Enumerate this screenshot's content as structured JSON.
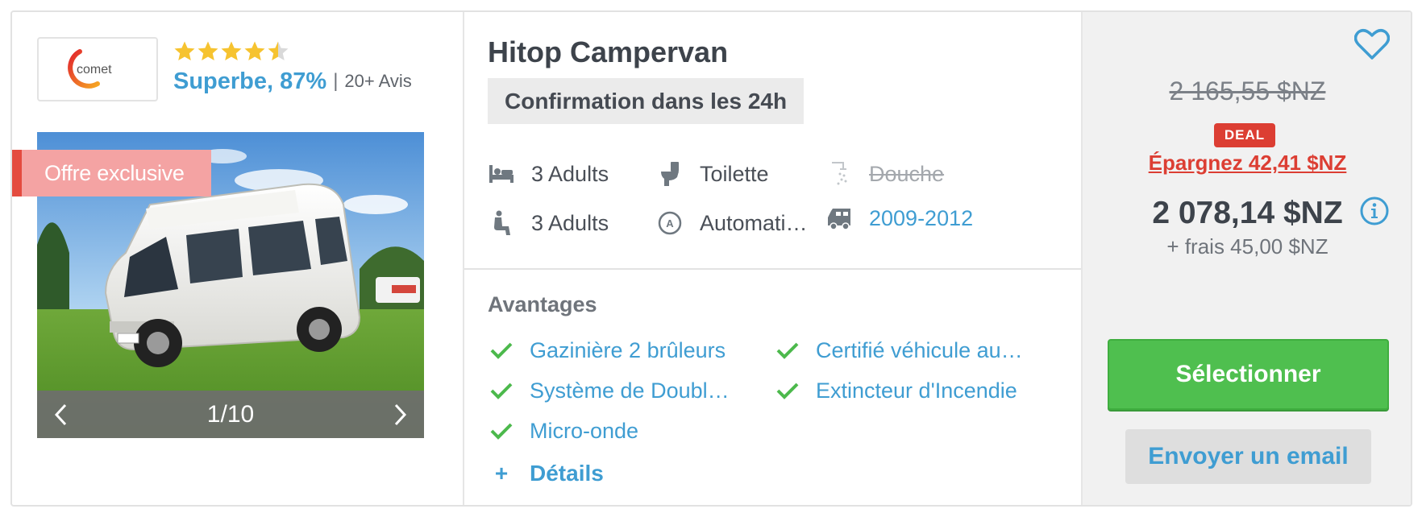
{
  "listing": {
    "supplier_logo_text": "comet",
    "rating": {
      "stars": 4.5,
      "max_stars": 5,
      "score_label": "Superbe, 87%",
      "separator": "|",
      "reviews": "20+ Avis"
    },
    "badge": "Offre exclusive",
    "carousel": {
      "counter": "1/10"
    },
    "title": "Hitop Campervan",
    "confirmation": "Confirmation dans les 24h",
    "features": [
      {
        "icon": "bed-icon",
        "label": "3 Adults",
        "style": "normal"
      },
      {
        "icon": "toilet-icon",
        "label": "Toilette",
        "style": "normal"
      },
      {
        "icon": "shower-icon",
        "label": "Douche",
        "style": "strike"
      },
      {
        "icon": "seat-icon",
        "label": "3 Adults",
        "style": "normal"
      },
      {
        "icon": "transmission-icon",
        "label": "Automati…",
        "style": "normal"
      },
      {
        "icon": "vehicle-year-icon",
        "label": "2009-2012",
        "style": "link"
      }
    ],
    "advantages": {
      "title": "Avantages",
      "items": [
        "Gazinière 2 brûleurs",
        "Certifié véhicule au…",
        "Système de Doubl…",
        "Extincteur d'Incendie",
        "Micro-onde"
      ],
      "details_icon": "+",
      "details_label": "Détails"
    },
    "pricing": {
      "old_price": "2 165,55 $NZ",
      "deal_badge": "DEAL",
      "savings": "Épargnez 42,41 $NZ",
      "price": "2 078,14 $NZ",
      "fees": "+ frais 45,00 $NZ"
    },
    "actions": {
      "select_label": "Sélectionner",
      "email_label": "Envoyer un email"
    }
  },
  "colors": {
    "accent_blue": "#3f9dd2",
    "select_green": "#4fbf4f",
    "deal_red": "#dc3e33",
    "exclusive_pink": "#f4a3a3",
    "check_green": "#4cb94c"
  }
}
